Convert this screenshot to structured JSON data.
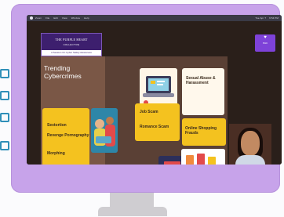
{
  "menubar": {
    "items": [
      "Zoom",
      "File",
      "Edit",
      "View",
      "Window",
      "Help"
    ],
    "right": [
      "Tue Apr 7",
      "9:54 PM"
    ]
  },
  "brand": {
    "title": "THE PURPLE HEART",
    "subtitle": "COLLECTIVE",
    "tagline": "A Session On Cyber Safety Awareness"
  },
  "corner_logo": {
    "text": "PHC"
  },
  "slide": {
    "title_line1": "Trending",
    "title_line2": "Cybercrimes",
    "left_items": [
      "Sextortion",
      "Revenge Pornography",
      "Morphing"
    ],
    "mid_items": [
      "Job Scam",
      "Romance Scam"
    ],
    "right_top": "Sexual Abuse & Harassment",
    "right_item": "Online Shopping Frauds"
  },
  "colors": {
    "accent": "#f4c21f",
    "brand": "#3d1f6e",
    "monitor": "#c7a3ea"
  }
}
